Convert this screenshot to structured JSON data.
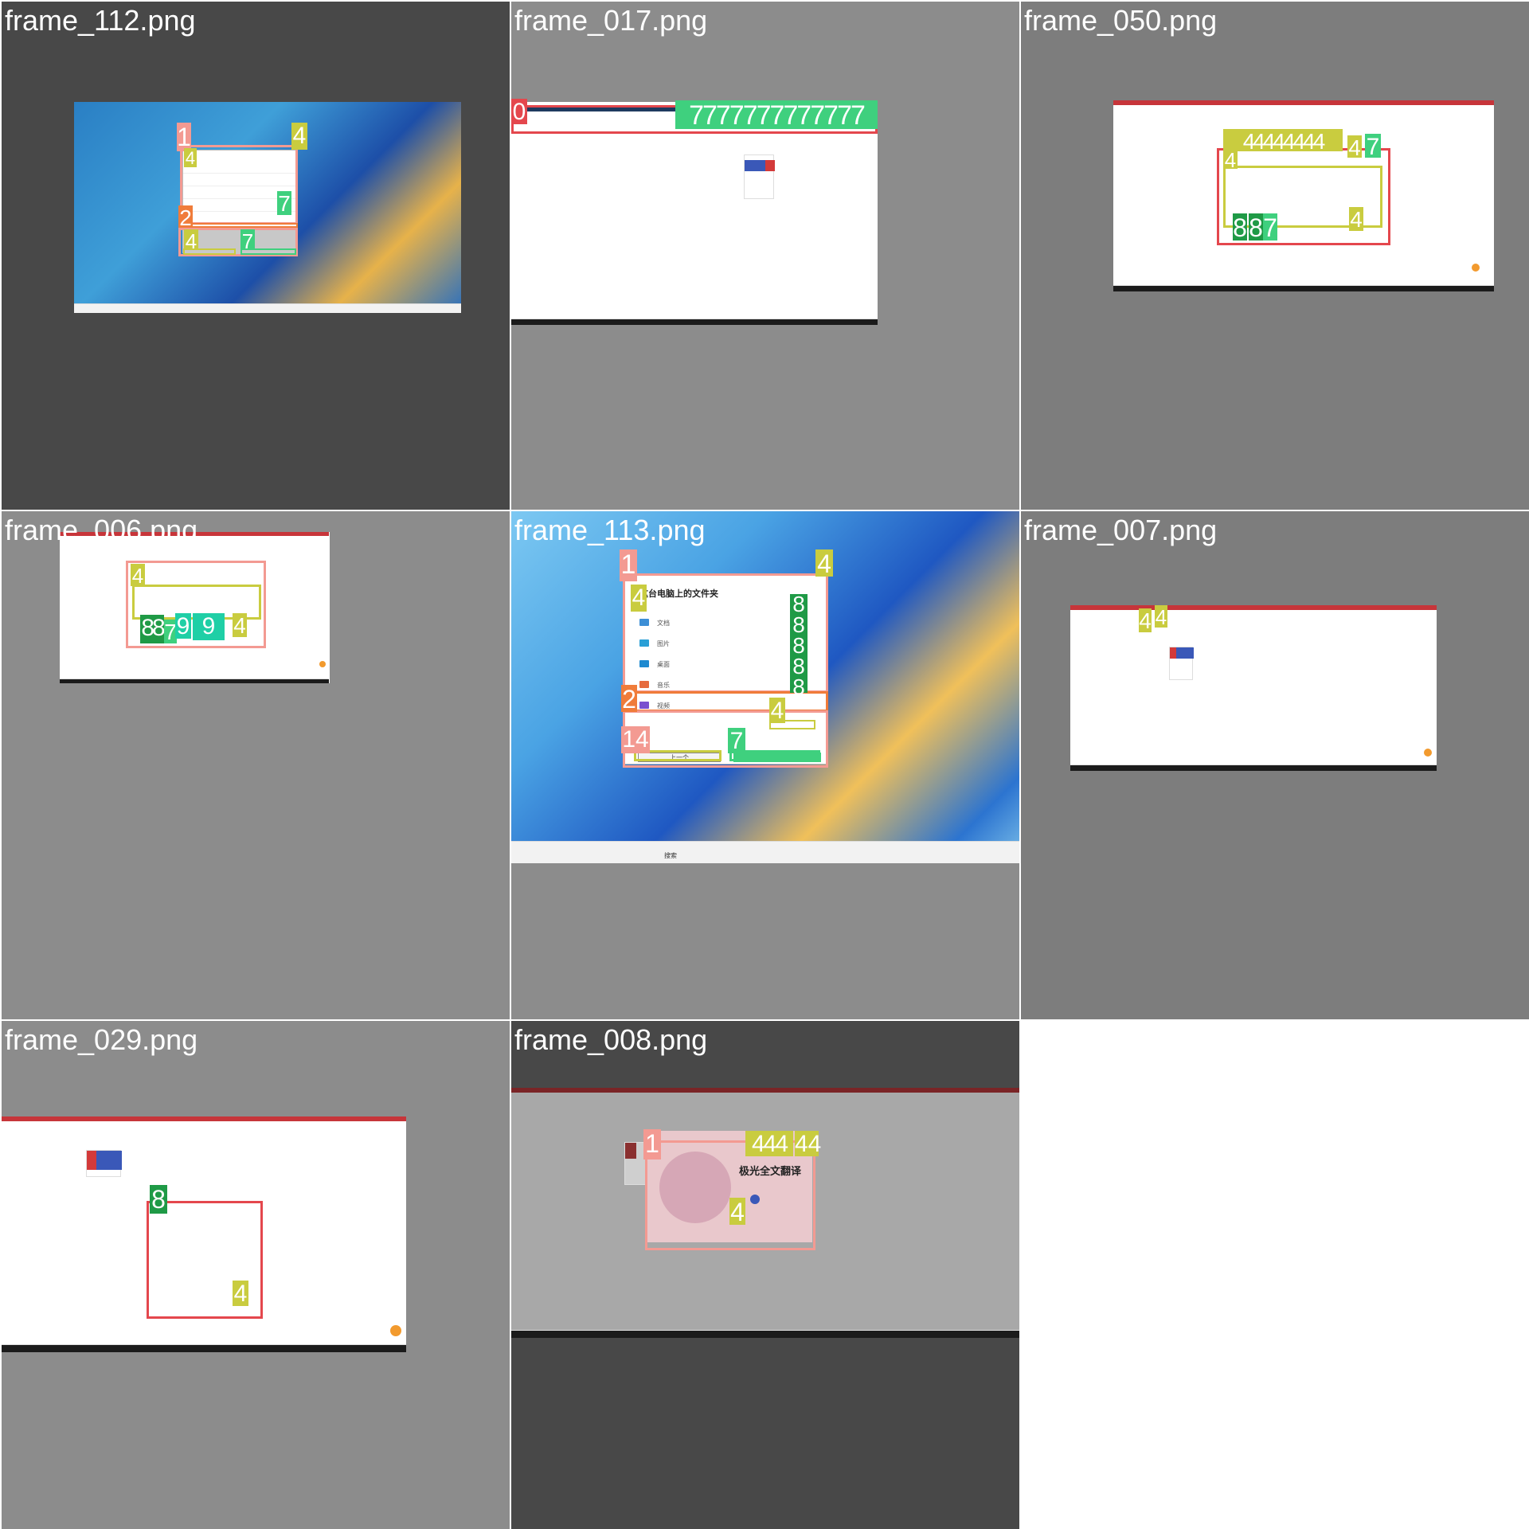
{
  "frames": [
    {
      "caption": "frame_112.png"
    },
    {
      "caption": "frame_017.png"
    },
    {
      "caption": "frame_050.png"
    },
    {
      "caption": "frame_006.png"
    },
    {
      "caption": "frame_113.png"
    },
    {
      "caption": "frame_007.png"
    },
    {
      "caption": "frame_029.png"
    },
    {
      "caption": "frame_008.png"
    }
  ],
  "frame113": {
    "dialog_title": "这台电脑上的文件夹",
    "rows": [
      "文档",
      "图片",
      "桌面",
      "音乐",
      "视频"
    ],
    "prev_button": "上一个",
    "search_label": "搜索"
  },
  "frame008": {
    "promo_title": "极光全文翻译"
  },
  "labels": {
    "l0": "0",
    "l1": "1",
    "l2": "2",
    "l4": "4",
    "l7": "7",
    "l8": "8",
    "l9": "9",
    "l14": "14",
    "l44": "44"
  },
  "tags7": "7777777777777"
}
